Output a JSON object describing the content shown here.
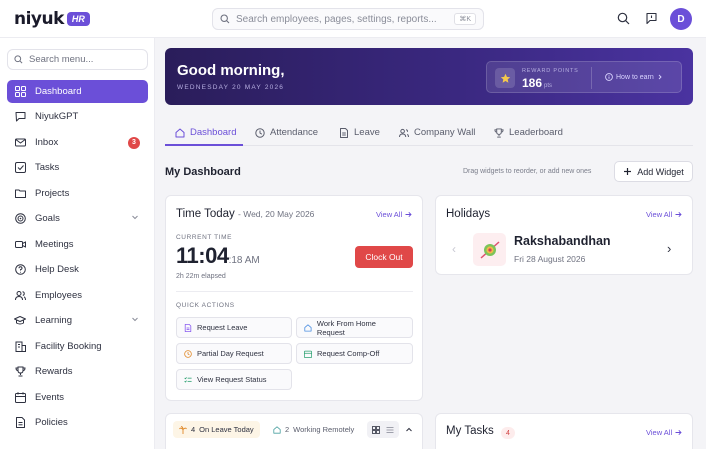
{
  "brand": {
    "name": "niyuk",
    "badge": "HR"
  },
  "topbar": {
    "search_placeholder": "Search employees, pages, settings, reports...",
    "shortcut": "⌘K",
    "avatar_initial": "D"
  },
  "sidebar": {
    "search_placeholder": "Search menu...",
    "items": [
      {
        "label": "Dashboard",
        "icon": "grid-icon",
        "active": true
      },
      {
        "label": "NiyukGPT",
        "icon": "chat-icon"
      },
      {
        "label": "Inbox",
        "icon": "mail-icon",
        "badge": "3"
      },
      {
        "label": "Tasks",
        "icon": "checkbox-icon"
      },
      {
        "label": "Projects",
        "icon": "folder-icon"
      },
      {
        "label": "Goals",
        "icon": "target-icon",
        "expandable": true
      },
      {
        "label": "Meetings",
        "icon": "video-icon"
      },
      {
        "label": "Help Desk",
        "icon": "help-icon"
      },
      {
        "label": "Employees",
        "icon": "users-icon"
      },
      {
        "label": "Learning",
        "icon": "graduation-icon",
        "expandable": true
      },
      {
        "label": "Facility Booking",
        "icon": "building-icon"
      },
      {
        "label": "Rewards",
        "icon": "trophy-icon"
      },
      {
        "label": "Events",
        "icon": "calendar-icon"
      },
      {
        "label": "Policies",
        "icon": "document-icon"
      }
    ]
  },
  "hero": {
    "greeting": "Good morning,",
    "date": "WEDNESDAY 20 MAY 2026",
    "reward_label": "REWARD POINTS",
    "reward_value": "186",
    "reward_unit": "pts",
    "how_to_earn": "How to earn"
  },
  "tabs": [
    {
      "label": "Dashboard",
      "icon": "home-icon",
      "active": true
    },
    {
      "label": "Attendance",
      "icon": "clock-icon"
    },
    {
      "label": "Leave",
      "icon": "file-icon"
    },
    {
      "label": "Company Wall",
      "icon": "people-icon"
    },
    {
      "label": "Leaderboard",
      "icon": "trophy-icon"
    }
  ],
  "dashboard": {
    "title": "My Dashboard",
    "hint": "Drag widgets to reorder, or add new ones",
    "add_widget": "Add Widget"
  },
  "time_today": {
    "title": "Time Today",
    "date": "- Wed, 20 May 2026",
    "view_all": "View All",
    "current_time_label": "CURRENT TIME",
    "time": "11:04",
    "seconds_ampm": ":18 AM",
    "elapsed": "2h 22m elapsed",
    "clock_out": "Clock Out",
    "quick_actions_label": "QUICK ACTIONS",
    "actions": [
      {
        "label": "Request Leave",
        "icon": "file-icon",
        "color": "#8a5cf0"
      },
      {
        "label": "Work From Home Request",
        "icon": "home-icon",
        "color": "#4a8de0"
      },
      {
        "label": "Partial Day Request",
        "icon": "clock-icon",
        "color": "#e08a2a"
      },
      {
        "label": "Request Comp-Off",
        "icon": "calendar-icon",
        "color": "#2aa070"
      },
      {
        "label": "View Request Status",
        "icon": "list-icon",
        "color": "#2aa070"
      }
    ]
  },
  "holidays": {
    "title": "Holidays",
    "view_all": "View All",
    "name": "Rakshabandhan",
    "date": "Fri 28 August 2026"
  },
  "availability": {
    "on_leave_count": "4",
    "on_leave_label": "On Leave Today",
    "remote_count": "2",
    "remote_label": "Working Remotely"
  },
  "my_tasks": {
    "title": "My Tasks",
    "count": "4",
    "view_all": "View All"
  },
  "colors": {
    "accent": "#6b4fd8",
    "danger": "#e04848",
    "hero_dark": "#2a1d5a"
  }
}
